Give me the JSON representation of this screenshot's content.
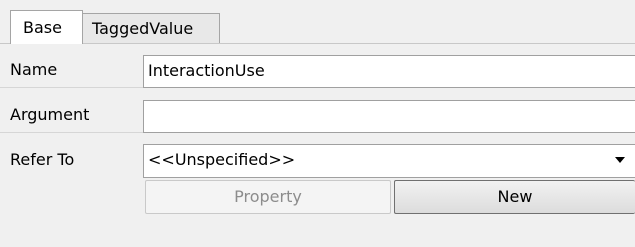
{
  "tabs": [
    {
      "label": "Base",
      "active": true
    },
    {
      "label": "TaggedValue",
      "active": false
    }
  ],
  "form": {
    "name": {
      "label": "Name",
      "value": "InteractionUse"
    },
    "argument": {
      "label": "Argument",
      "value": ""
    },
    "refer_to": {
      "label": "Refer To",
      "value": "<<Unspecified>>",
      "icon": "chevron-down-icon"
    }
  },
  "buttons": {
    "property": {
      "label": "Property",
      "enabled": false
    },
    "new": {
      "label": "New",
      "enabled": true
    }
  },
  "colors": {
    "background": "#f0f0f0",
    "field_background": "#ffffff",
    "disabled_text": "#8c8c8c"
  }
}
